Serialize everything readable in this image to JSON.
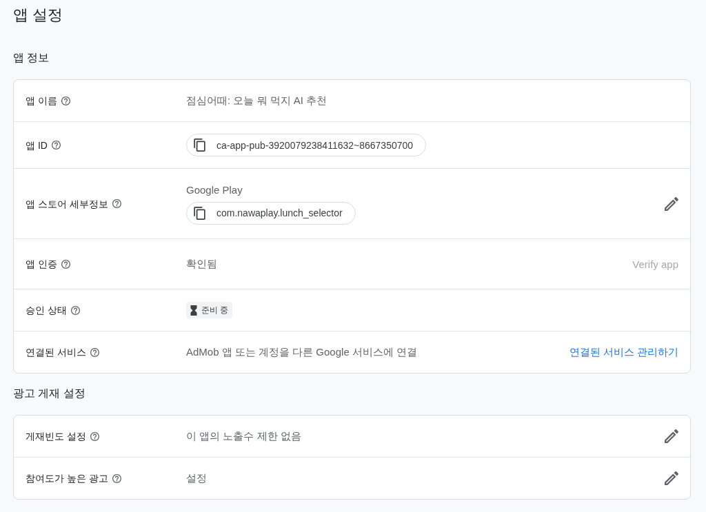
{
  "page_title": "앱 설정",
  "sections": [
    {
      "title": "앱 정보",
      "rows": [
        {
          "label": "앱 이름",
          "kind": "text",
          "value": "점심어때: 오늘 뭐 먹지 AI 추천",
          "editable": false
        },
        {
          "label": "앱 ID",
          "kind": "chip",
          "value": "ca-app-pub-3920079238411632~8667350700",
          "editable": false
        },
        {
          "label": "앱 스토어 세부정보",
          "kind": "store",
          "store": "Google Play",
          "value": "com.nawaplay.lunch_selector",
          "editable": true
        },
        {
          "label": "앱 인증",
          "kind": "text",
          "value": "확인됨",
          "editable": false,
          "action": {
            "kind": "button",
            "label": "Verify app",
            "disabled": true
          }
        },
        {
          "label": "승인 상태",
          "kind": "status",
          "value": "준비 중",
          "editable": false
        },
        {
          "label": "연결된 서비스",
          "kind": "text",
          "value": "AdMob 앱 또는 계정을 다른 Google 서비스에 연결",
          "editable": false,
          "action": {
            "kind": "link",
            "label": "연결된 서비스 관리하기",
            "disabled": false
          }
        }
      ]
    },
    {
      "title": "광고 게재 설정",
      "rows": [
        {
          "label": "게재빈도 설정",
          "kind": "text",
          "value": "이 앱의 노출수 제한 없음",
          "editable": true
        },
        {
          "label": "참여도가 높은 광고",
          "kind": "text",
          "value": "설정",
          "editable": true
        }
      ]
    }
  ]
}
